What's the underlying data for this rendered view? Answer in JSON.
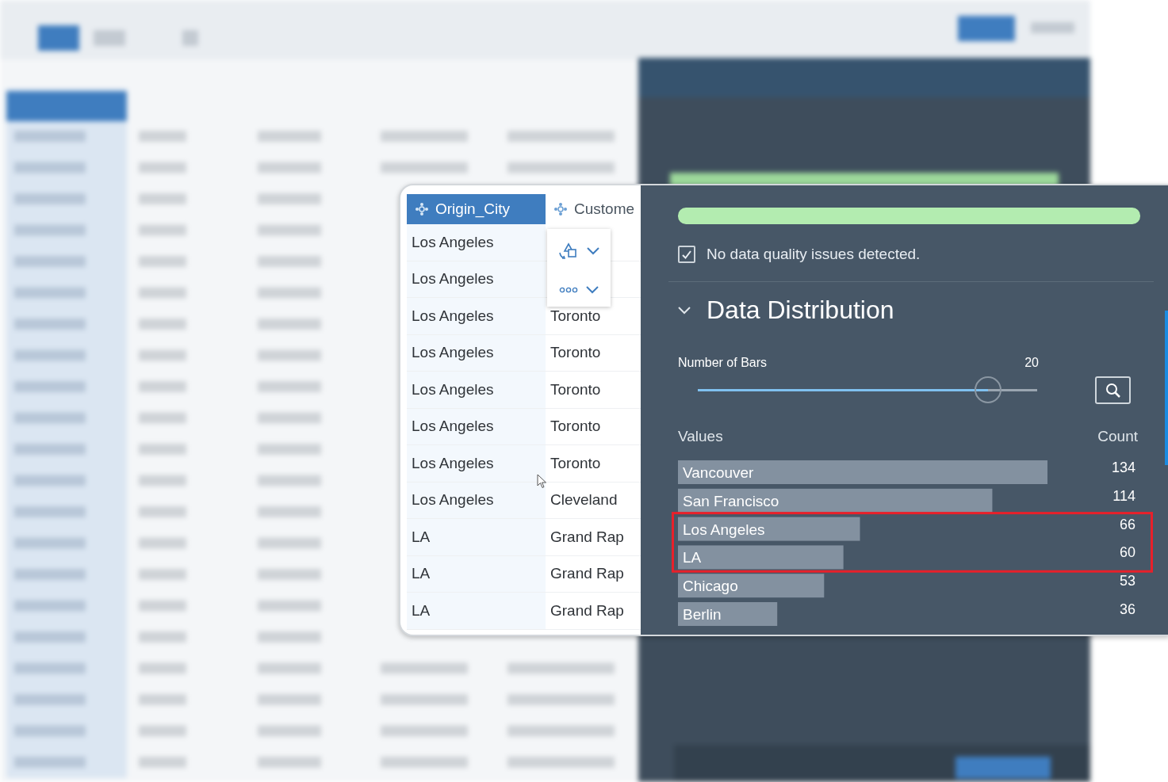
{
  "table": {
    "columns": [
      {
        "label": "Origin_City",
        "selected": true
      },
      {
        "label": "Custome",
        "selected": false
      }
    ],
    "rows": [
      {
        "cells": [
          "Los Angeles"
        ]
      },
      {
        "cells": [
          "Los Angeles"
        ]
      },
      {
        "cells": [
          "Los Angeles",
          "Toronto"
        ]
      },
      {
        "cells": [
          "Los Angeles",
          "Toronto"
        ]
      },
      {
        "cells": [
          "Los Angeles",
          "Toronto"
        ]
      },
      {
        "cells": [
          "Los Angeles",
          "Toronto"
        ]
      },
      {
        "cells": [
          "Los Angeles",
          "Toronto"
        ]
      },
      {
        "cells": [
          "Los Angeles",
          "Cleveland"
        ]
      },
      {
        "cells": [
          "LA",
          "Grand Rap"
        ]
      },
      {
        "cells": [
          "LA",
          "Grand Rap"
        ]
      },
      {
        "cells": [
          "LA",
          "Grand Rap"
        ]
      }
    ],
    "column_menu": [
      {
        "kind": "transform"
      },
      {
        "kind": "more"
      }
    ]
  },
  "data_quality": {
    "level": 1,
    "checked": true,
    "message": "No data quality issues detected."
  },
  "data_distribution": {
    "title": "Data Distribution",
    "expanded": true,
    "bars_slider": {
      "label": "Number of Bars",
      "reading": "20",
      "level": 0.855
    },
    "values_header": "Values",
    "highlighted": [
      false,
      false,
      true,
      true,
      false,
      false
    ],
    "chart_data": {
      "type": "bar",
      "orientation": "horizontal",
      "categories": [
        "Vancouver",
        "San Francisco",
        "Los Angeles",
        "LA",
        "Chicago",
        "Berlin"
      ],
      "series": [
        {
          "name": "Count",
          "color": "#8391a0",
          "values": [
            134,
            114,
            66,
            60,
            53,
            36
          ]
        }
      ],
      "xlim": [
        0,
        134
      ],
      "data_labels": true
    }
  }
}
